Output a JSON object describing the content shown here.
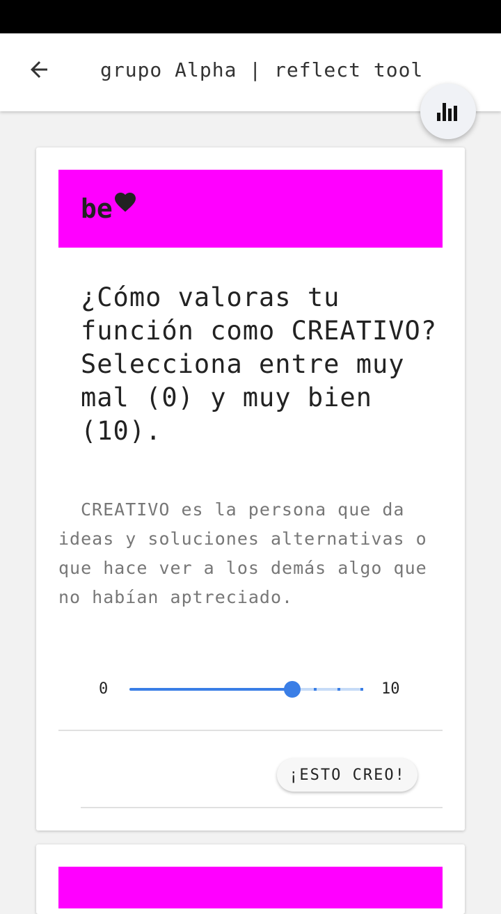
{
  "app_bar": {
    "title": "grupo Alpha | reflect tool",
    "back_icon": "arrow-left-icon",
    "fab_icon": "bar-chart-icon"
  },
  "card": {
    "banner_text": "be",
    "banner_icon": "heart-icon",
    "banner_color": "#ff00ff",
    "question": "¿Cómo valoras tu función como CREATIVO? Selecciona entre muy mal (0) y muy bien (10).",
    "description": "CREATIVO es la persona que da ideas y soluciones alternativas o que hace ver a los demás algo que no habían aptreciado.",
    "slider": {
      "min_label": "0",
      "max_label": "10",
      "min": 0,
      "max": 10,
      "value": 7,
      "accent_color": "#3a7ee6"
    },
    "button_label": "¡ESTO CREO!"
  }
}
